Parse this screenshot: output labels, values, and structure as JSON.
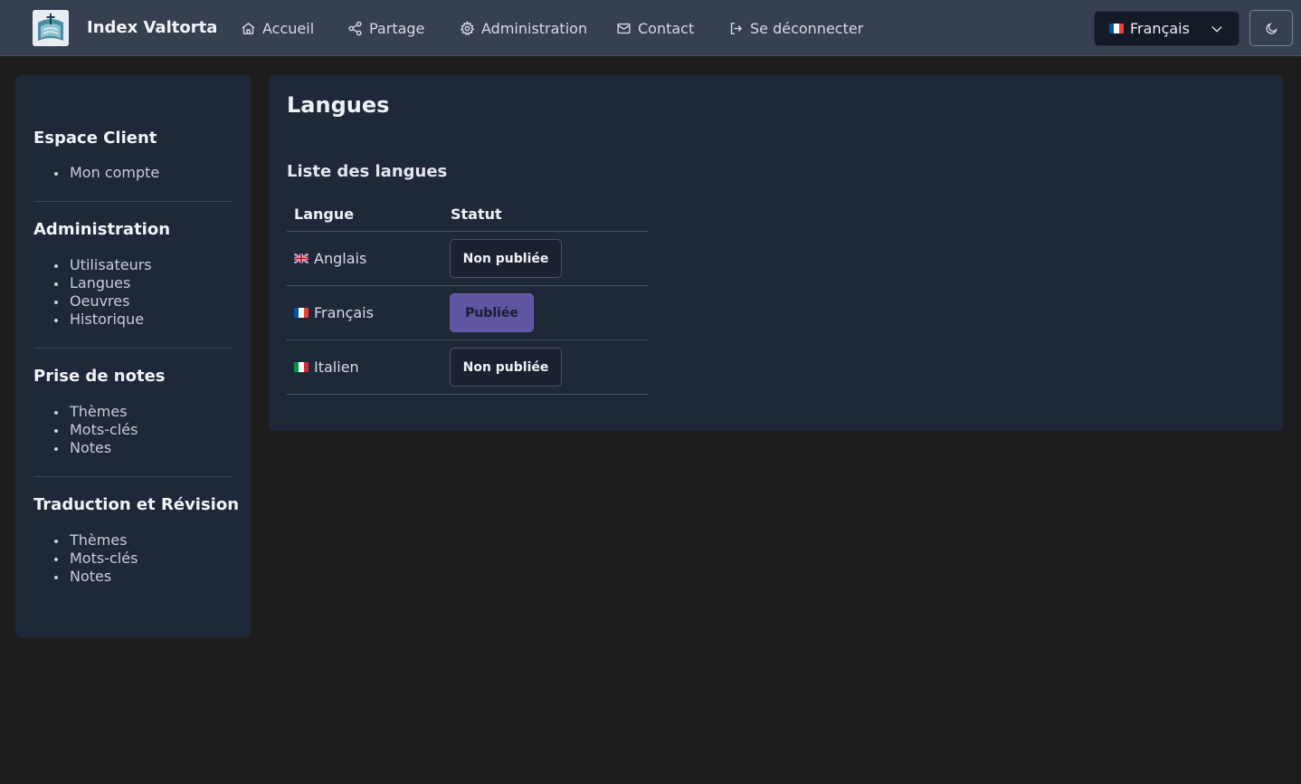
{
  "navbar": {
    "brand": "Index Valtorta",
    "items": [
      {
        "label": "Accueil",
        "icon": "home-icon"
      },
      {
        "label": "Partage",
        "icon": "share-icon"
      },
      {
        "label": "Administration",
        "icon": "gear-icon"
      },
      {
        "label": "Contact",
        "icon": "mail-icon"
      },
      {
        "label": "Se déconnecter",
        "icon": "logout-icon"
      }
    ],
    "language_selected": "Français",
    "theme_toggle_icon": "moon-icon"
  },
  "sidebar": {
    "sections": [
      {
        "title": "Espace Client",
        "items": [
          "Mon compte"
        ]
      },
      {
        "title": "Administration",
        "items": [
          "Utilisateurs",
          "Langues",
          "Oeuvres",
          "Historique"
        ]
      },
      {
        "title": "Prise de notes",
        "items": [
          "Thèmes",
          "Mots-clés",
          "Notes"
        ]
      },
      {
        "title": "Traduction et Révision",
        "items": [
          "Thèmes",
          "Mots-clés",
          "Notes"
        ]
      }
    ]
  },
  "main": {
    "title": "Langues",
    "section_title": "Liste des langues",
    "table": {
      "headers": [
        "Langue",
        "Statut"
      ],
      "rows": [
        {
          "flag": "gb",
          "language": "Anglais",
          "status": "Non publiée",
          "published": false
        },
        {
          "flag": "fr",
          "language": "Français",
          "status": "Publiée",
          "published": true
        },
        {
          "flag": "it",
          "language": "Italien",
          "status": "Non publiée",
          "published": false
        }
      ]
    }
  },
  "colors": {
    "navbar_bg": "#374050",
    "page_bg": "#1d1d1e",
    "card_bg": "#1e2839",
    "published_bg": "#5f55a0"
  }
}
